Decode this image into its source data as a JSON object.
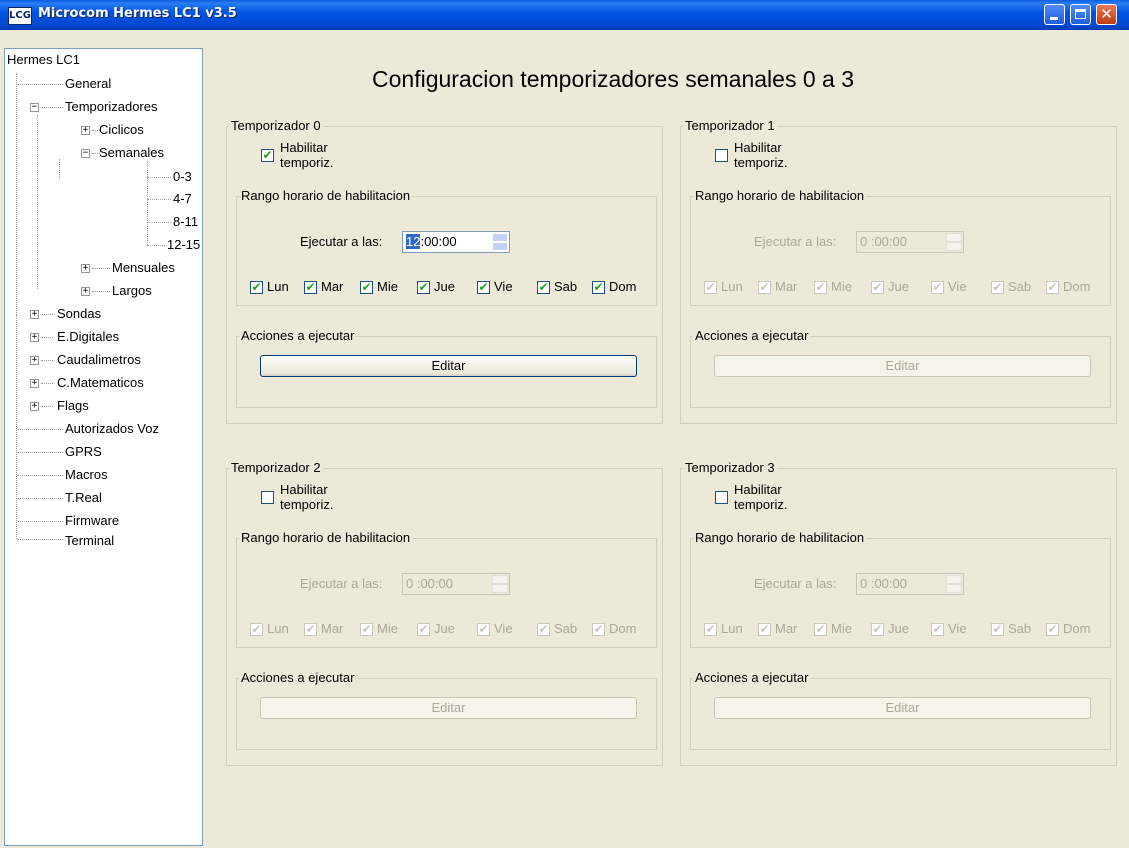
{
  "window": {
    "title": "Microcom Hermes LC1 v3.5",
    "icon_text": "LCG",
    "buttons": [
      "minimize-icon",
      "maximize-icon",
      "close-icon"
    ]
  },
  "tree": {
    "root": "Hermes LC1",
    "general": "General",
    "temporizadores": "Temporizadores",
    "ciclicos": "Ciclicos",
    "semanales": "Semanales",
    "sem_0_3": "0-3",
    "sem_4_7": "4-7",
    "sem_8_11": "8-11",
    "sem_12_15": "12-15",
    "mensuales": "Mensuales",
    "largos": "Largos",
    "sondas": "Sondas",
    "edigitales": "E.Digitales",
    "caudalimetros": "Caudalimetros",
    "cmatematicos": "C.Matematicos",
    "flags": "Flags",
    "autorizados": "Autorizados Voz",
    "gprs": "GPRS",
    "macros": "Macros",
    "treal": "T.Real",
    "firmware": "Firmware",
    "terminal": "Terminal",
    "expand_plus": "+",
    "expand_minus": "−"
  },
  "page": {
    "title": "Configuracion temporizadores semanales  0 a 3"
  },
  "common": {
    "habilitar": "Habilitar",
    "temporiz": "temporiz.",
    "rango": "Rango horario de habilitacion",
    "ejecutar": "Ejecutar a las:",
    "acciones": "Acciones a ejecutar",
    "editar": "Editar",
    "days": [
      "Lun",
      "Mar",
      "Mie",
      "Jue",
      "Vie",
      "Sab",
      "Dom"
    ],
    "check_mark": "✔"
  },
  "timers": [
    {
      "label": "Temporizador  0",
      "enabled": true,
      "time_hour": "12",
      "time_rest": ":00:00",
      "days_checked": [
        true,
        true,
        true,
        true,
        true,
        true,
        true
      ]
    },
    {
      "label": "Temporizador  1",
      "enabled": false,
      "time_hour": "",
      "time_rest": "0 :00:00",
      "days_checked": [
        true,
        true,
        true,
        true,
        true,
        true,
        true
      ]
    },
    {
      "label": "Temporizador  2",
      "enabled": false,
      "time_hour": "",
      "time_rest": "0 :00:00",
      "days_checked": [
        true,
        true,
        true,
        true,
        true,
        true,
        true
      ]
    },
    {
      "label": "Temporizador  3",
      "enabled": false,
      "time_hour": "",
      "time_rest": "0 :00:00",
      "days_checked": [
        true,
        true,
        true,
        true,
        true,
        true,
        true
      ]
    }
  ],
  "colors": {
    "titlebar": "#0055e5",
    "face": "#ece9d8",
    "disabled_text": "#aca899",
    "selection": "#316ac5"
  }
}
